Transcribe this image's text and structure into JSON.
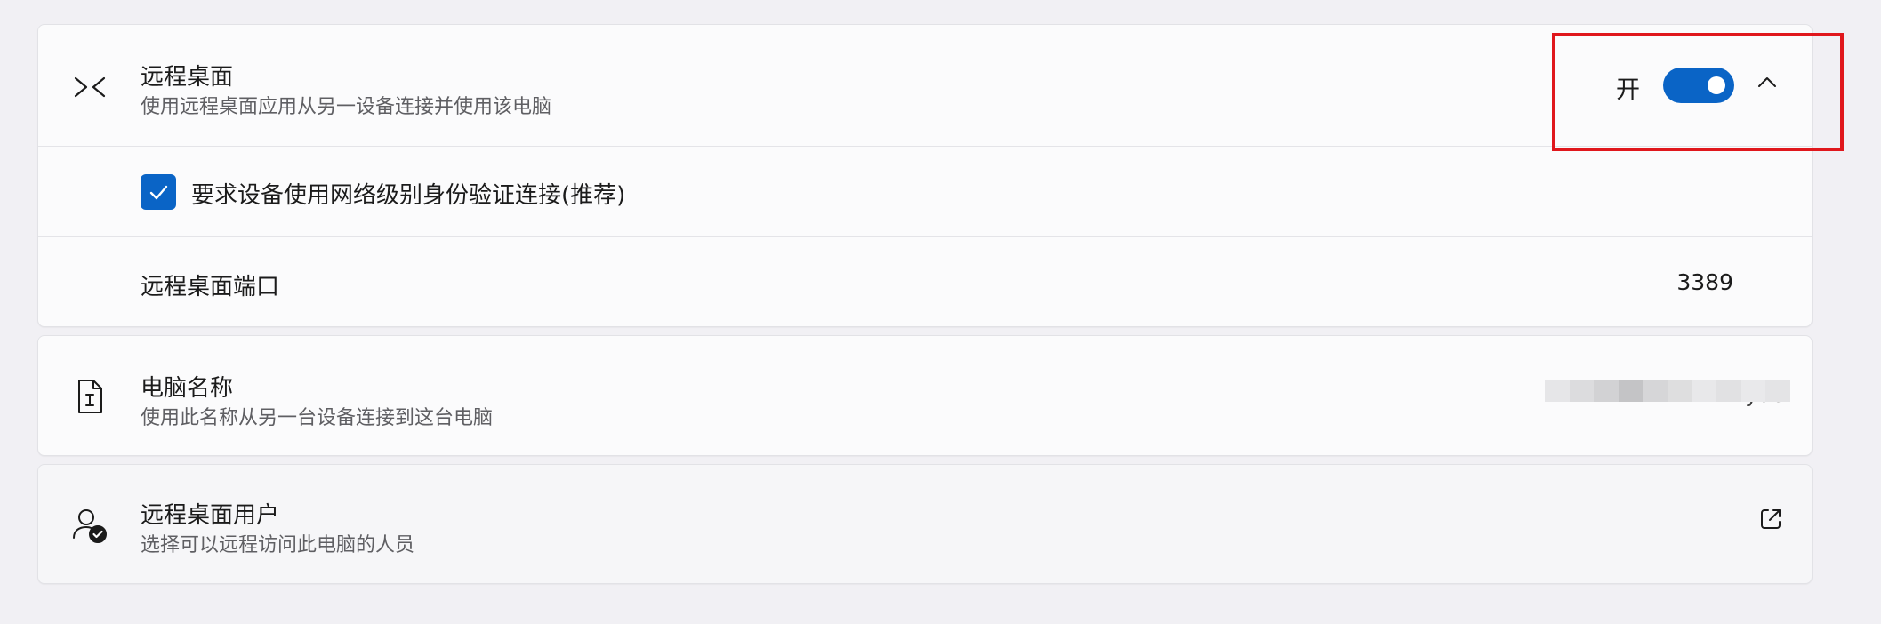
{
  "remote_desktop": {
    "title": "远程桌面",
    "subtitle": "使用远程桌面应用从另一设备连接并使用该电脑",
    "toggle_state": "开",
    "toggle_on": true,
    "icon": "remote-desktop-icon",
    "nla_checkbox": {
      "label": "要求设备使用网络级别身份验证连接(推荐)",
      "checked": true
    },
    "port": {
      "label": "远程桌面端口",
      "value": "3389"
    }
  },
  "pc_name": {
    "title": "电脑名称",
    "subtitle": "使用此名称从另一台设备连接到这台电脑",
    "value_suffix": "ydc",
    "icon": "pc-name-document-icon"
  },
  "remote_users": {
    "title": "远程桌面用户",
    "subtitle": "选择可以远程访问此电脑的人员",
    "icon": "user-check-icon"
  },
  "colors": {
    "accent": "#0a64c6",
    "highlight": "#e0171c",
    "background": "#f1f0f4",
    "card": "#fbfbfc"
  }
}
